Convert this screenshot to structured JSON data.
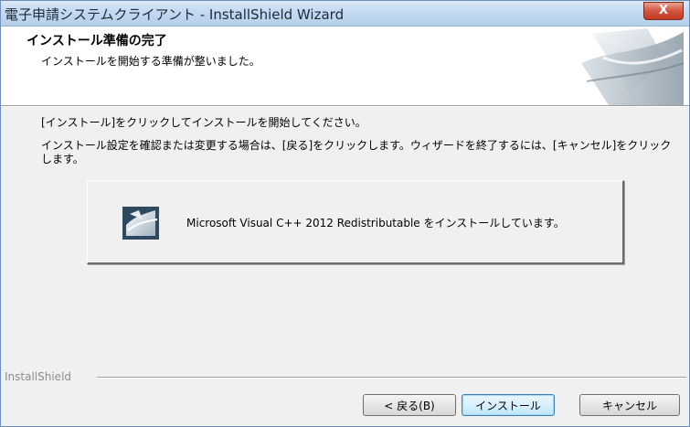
{
  "window": {
    "title": "電子申請システムクライアント - InstallShield Wizard",
    "close_glyph": "X"
  },
  "header": {
    "title": "インストール準備の完了",
    "subtitle": "インストールを開始する準備が整いました。"
  },
  "body": {
    "instruction_1": "[インストール]をクリックしてインストールを開始してください。",
    "instruction_2": "インストール設定を確認または変更する場合は、[戻る]をクリックします。ウィザードを終了するには、[キャンセル]をクリックします。"
  },
  "progress": {
    "icon": "installer-package-icon",
    "status_text": "Microsoft Visual C++ 2012 Redistributable をインストールしています。"
  },
  "footer": {
    "brand": "InstallShield",
    "back_label": "< 戻る(B)",
    "install_label": "インストール",
    "cancel_label": "キャンセル"
  },
  "colors": {
    "titlebar": "#c3d9f0",
    "close_button": "#d2553f",
    "default_button_border": "#3c7fb1"
  }
}
